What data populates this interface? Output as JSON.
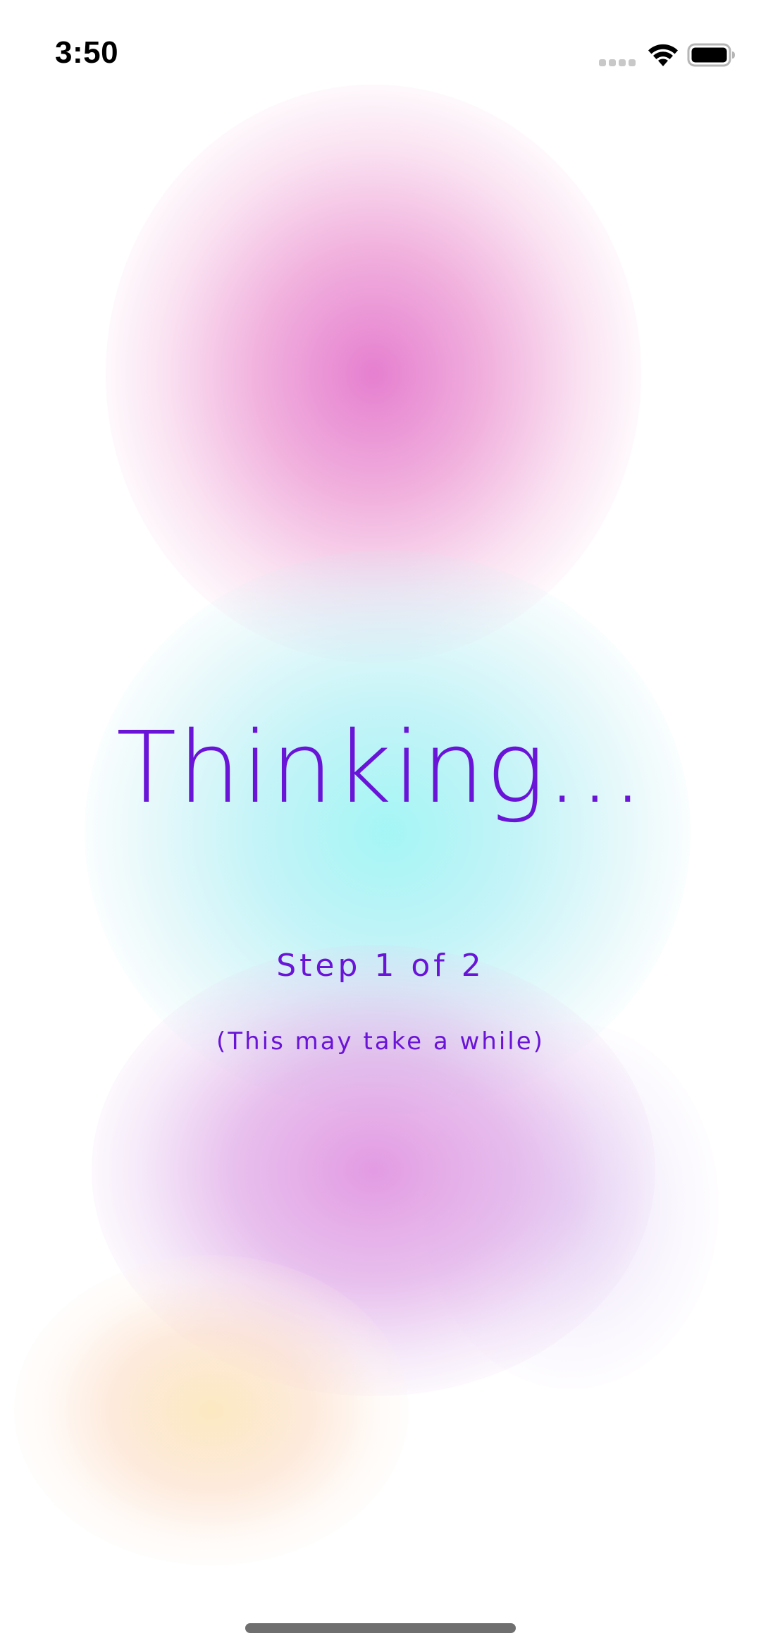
{
  "status_bar": {
    "time": "3:50",
    "signal_icon": "cellular-signal-icon",
    "wifi_icon": "wifi-icon",
    "battery_icon": "battery-icon"
  },
  "main": {
    "title": "Thinking...",
    "step": "Step 1 of 2",
    "hint": "(This may take a while)"
  },
  "colors": {
    "accent_text": "#6a14d8",
    "background": "#ffffff"
  }
}
